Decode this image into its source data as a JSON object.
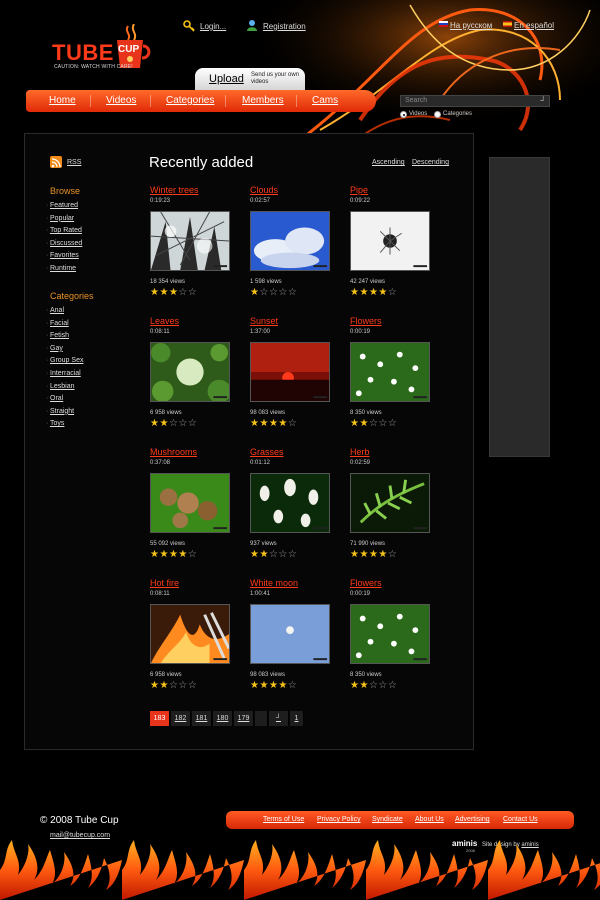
{
  "brand": {
    "name": "TUBE",
    "cup": "CUP",
    "tagline": "CAUTION: WATCH WITH CARE!"
  },
  "top_links": {
    "login": "Login...",
    "registration": "Registration",
    "russian": "На русском",
    "spanish": "En español"
  },
  "upload": {
    "label": "Upload",
    "sub": "Send us your own videos"
  },
  "nav": [
    {
      "label": "Home"
    },
    {
      "label": "Videos"
    },
    {
      "label": "Categories"
    },
    {
      "label": "Members"
    },
    {
      "label": "Cams"
    }
  ],
  "search": {
    "placeholder": "Search",
    "go_glyph": "┘",
    "options": [
      {
        "label": "Videos",
        "selected": true
      },
      {
        "label": "Categories",
        "selected": false
      }
    ]
  },
  "sidebar": {
    "rss": "RSS",
    "browse_title": "Browse",
    "browse": [
      "Featured",
      "Popular",
      "Top Rated",
      "Discussed",
      "Favorites",
      "Runtime"
    ],
    "categories_title": "Categories",
    "categories": [
      "Anal",
      "Facial",
      "Fetish",
      "Gay",
      "Group Sex",
      "Interracial",
      "Lesbian",
      "Oral",
      "Straight",
      "Toys"
    ]
  },
  "main": {
    "heading": "Recently added",
    "sort_asc": "Ascending",
    "sort_desc": "Descending",
    "videos": [
      {
        "title": "Winter trees",
        "duration": "0:19:23",
        "views": "18 354 views",
        "rating": 3,
        "thumb": "winter"
      },
      {
        "title": "Clouds",
        "duration": "0:02:57",
        "views": "1 598 views",
        "rating": 1,
        "thumb": "clouds"
      },
      {
        "title": "Pipe",
        "duration": "0:09:22",
        "views": "42 247 views",
        "rating": 4,
        "thumb": "pipe"
      },
      {
        "title": "Leaves",
        "duration": "0:08:11",
        "views": "6 958 views",
        "rating": 2,
        "thumb": "leaves"
      },
      {
        "title": "Sunset",
        "duration": "1:37:00",
        "views": "98 083 views",
        "rating": 4,
        "thumb": "sunset"
      },
      {
        "title": "Flowers",
        "duration": "0:00:19",
        "views": "8 350 views",
        "rating": 2,
        "thumb": "flowers"
      },
      {
        "title": "Mushrooms",
        "duration": "0:37:08",
        "views": "55 092 views",
        "rating": 4,
        "thumb": "mushrooms"
      },
      {
        "title": "Grasses",
        "duration": "0:01:12",
        "views": "937 views",
        "rating": 2,
        "thumb": "grasses"
      },
      {
        "title": "Herb",
        "duration": "0:02:59",
        "views": "71 990 views",
        "rating": 4,
        "thumb": "herb"
      },
      {
        "title": "Hot fire",
        "duration": "0:08:11",
        "views": "6 958 views",
        "rating": 2,
        "thumb": "fire"
      },
      {
        "title": "White moon",
        "duration": "1:00:41",
        "views": "98 083 views",
        "rating": 4,
        "thumb": "moon"
      },
      {
        "title": "Flowers",
        "duration": "0:00:19",
        "views": "8 350 views",
        "rating": 2,
        "thumb": "flowers"
      }
    ],
    "pager": [
      "183",
      "182",
      "181",
      "180",
      "179",
      "",
      "┘",
      "1"
    ],
    "pager_active": 0
  },
  "footer": {
    "copyright": "© 2008 Tube Cup",
    "email": "mail@tubecup.com",
    "links": [
      "Terms of Use",
      "Privacy Policy",
      "Syndicate",
      "About Us",
      "Advertising",
      "Contact Us"
    ],
    "design_brand": "aminis",
    "design_year": "2008",
    "design_text": "Site design by",
    "design_link": "aminis"
  },
  "colors": {
    "accent": "#e8341a",
    "title_red": "#ff3b1a",
    "category_orange": "#e8922a",
    "star": "#f5c21a"
  }
}
